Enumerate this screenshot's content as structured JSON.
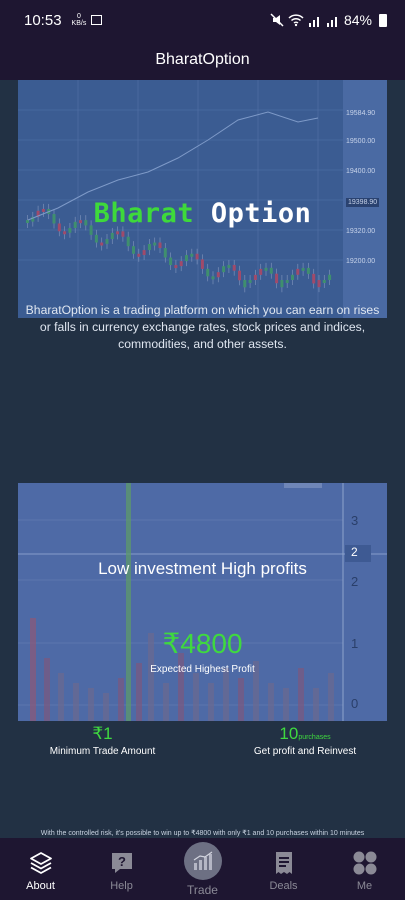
{
  "status_bar": {
    "time": "10:53",
    "net_speed_value": "0",
    "net_speed_unit": "KB/s",
    "battery": "84%"
  },
  "app": {
    "title": "BharatOption"
  },
  "hero": {
    "brand_part1": "Bharat",
    "brand_part2": "Option",
    "chart_price_labels": [
      "19584.90",
      "19500.00",
      "19400.00",
      "19398.90",
      "19320.00",
      "19200.00"
    ]
  },
  "description": "BharatOption is a trading platform on which you can earn on rises or falls in currency exchange rates, stock prices and indices, commodities, and other assets.",
  "promo": {
    "heading": "Low investment High profits",
    "amount": "₹4800",
    "amount_label": "Expected Highest Profit",
    "axis_labels": [
      "3",
      "2",
      "2",
      "1",
      "0"
    ]
  },
  "stats": [
    {
      "value": "₹1",
      "unit": "",
      "label": "Minimum Trade Amount"
    },
    {
      "value": "10",
      "unit": "purchases",
      "label": "Get profit and Reinvest"
    }
  ],
  "risk_note": "With the controlled risk, it's possible to win up to ₹4800 with only ₹1 and 10 purchases within 10 minutes",
  "nav": [
    {
      "label": "About",
      "icon": "layers-icon",
      "active": true
    },
    {
      "label": "Help",
      "icon": "question-icon",
      "active": false
    },
    {
      "label": "Trade",
      "icon": "chart-icon",
      "active": false
    },
    {
      "label": "Deals",
      "icon": "receipt-icon",
      "active": false
    },
    {
      "label": "Me",
      "icon": "grid-icon",
      "active": false
    }
  ],
  "colors": {
    "accent_green": "#3fd93f",
    "bar_bg": "#1e1631",
    "page_bg": "#223144"
  }
}
